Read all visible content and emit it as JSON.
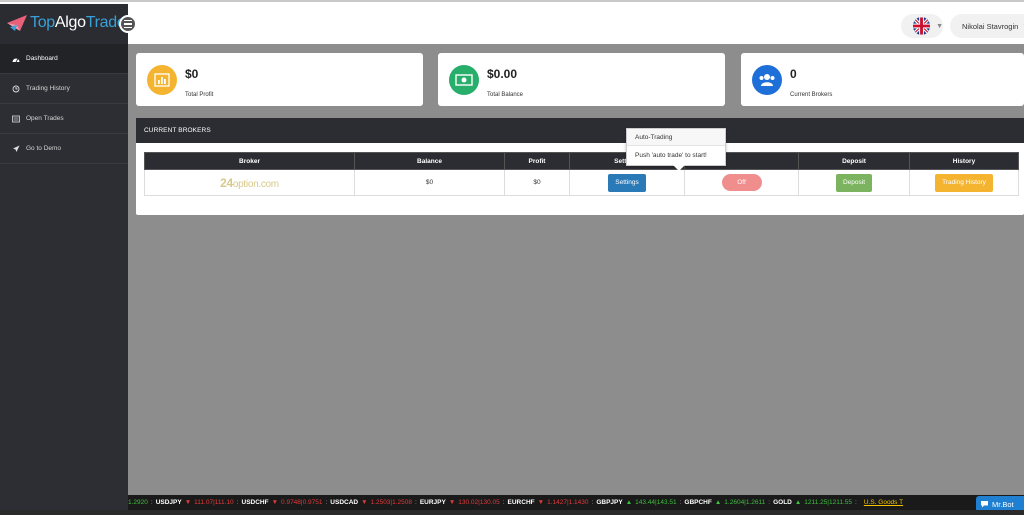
{
  "brand": {
    "logo_text_1": "Top",
    "logo_text_2": "Algo",
    "logo_text_3": "Trade"
  },
  "header": {
    "user_name": "Nikolai Stavrogin",
    "language_flag": "uk-flag-icon"
  },
  "sidebar": {
    "items": [
      {
        "label": "Dashboard",
        "icon": "dashboard-icon",
        "active": true
      },
      {
        "label": "Trading History",
        "icon": "history-icon",
        "active": false
      },
      {
        "label": "Open Trades",
        "icon": "list-icon",
        "active": false
      },
      {
        "label": "Go to Demo",
        "icon": "rocket-icon",
        "active": false
      }
    ]
  },
  "stats": [
    {
      "value": "$0",
      "label": "Total Profit",
      "icon": "bar-chart-icon",
      "color": "#f4b42f"
    },
    {
      "value": "$0.00",
      "label": "Total Balance",
      "icon": "money-icon",
      "color": "#27ae6a"
    },
    {
      "value": "0",
      "label": "Current Brokers",
      "icon": "users-icon",
      "color": "#1f6fd9"
    }
  ],
  "brokers_panel": {
    "title": "CURRENT BROKERS",
    "columns": [
      "Broker",
      "Balance",
      "Profit",
      "Settings",
      "",
      "Deposit",
      "History"
    ],
    "rows": [
      {
        "broker_main": "24",
        "broker_rest": "option.com",
        "balance": "$0",
        "profit": "$0",
        "settings_label": "Settings",
        "autotrade_label": "Off",
        "deposit_label": "Deposit",
        "history_label": "Trading History"
      }
    ]
  },
  "popover": {
    "title": "Auto-Trading",
    "body": "Push 'auto trade' to start!"
  },
  "ticker": {
    "lead": "1.2920",
    "items": [
      {
        "symbol": "USDJPY",
        "dir": "down",
        "quote": "111.07|111.10"
      },
      {
        "symbol": "USDCHF",
        "dir": "down",
        "quote": "0.9748|0.9751"
      },
      {
        "symbol": "USDCAD",
        "dir": "down",
        "quote": "1.2503|1.2508"
      },
      {
        "symbol": "EURJPY",
        "dir": "down",
        "quote": "130.02|130.05"
      },
      {
        "symbol": "EURCHF",
        "dir": "down",
        "quote": "1.1427|1.1430"
      },
      {
        "symbol": "GBPJPY",
        "dir": "up",
        "quote": "143.44|143.51"
      },
      {
        "symbol": "GBPCHF",
        "dir": "up",
        "quote": "1.2604|1.2611"
      },
      {
        "symbol": "GOLD",
        "dir": "up",
        "quote": "1211.25|1211.55"
      }
    ],
    "news": "U.S. Goods T"
  },
  "chat": {
    "label": "Mr.Bot"
  },
  "colors": {
    "sidebar_bg": "#2d2e33",
    "content_bg": "#8d8d8d",
    "accent": "#3aa0d8"
  }
}
